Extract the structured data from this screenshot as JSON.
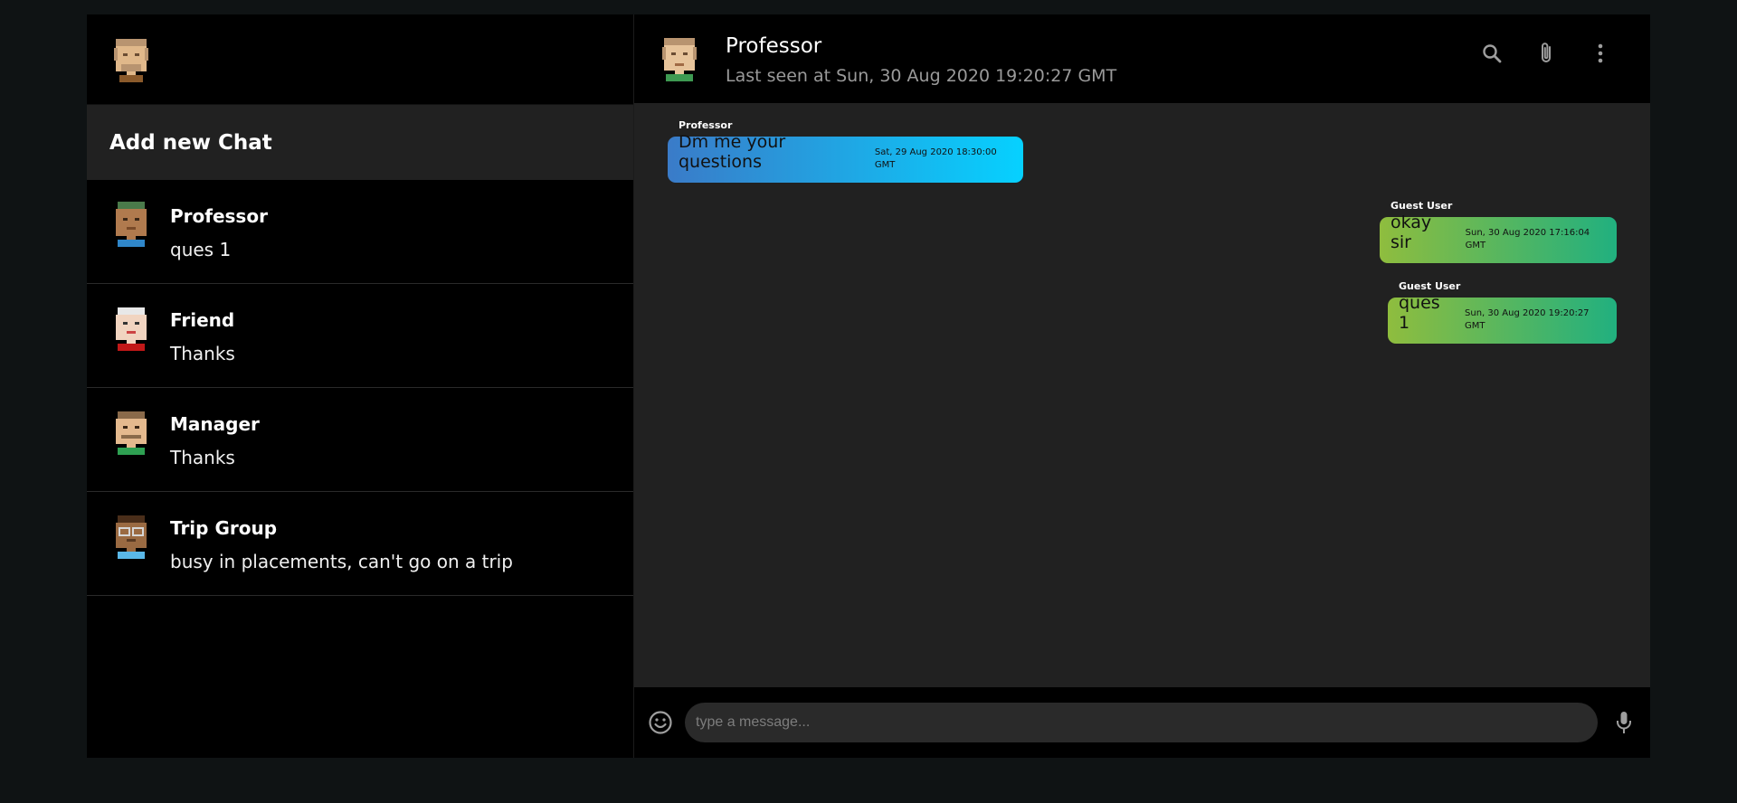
{
  "sidebar": {
    "add_chat_label": "Add new Chat",
    "chats": [
      {
        "name": "Professor",
        "last": "ques 1"
      },
      {
        "name": "Friend",
        "last": "Thanks"
      },
      {
        "name": "Manager",
        "last": "Thanks"
      },
      {
        "name": "Trip Group",
        "last": "busy in placements, can't go on a trip"
      }
    ]
  },
  "chat": {
    "title": "Professor",
    "subtitle": "Last seen at Sun, 30 Aug 2020 19:20:27 GMT",
    "messages": [
      {
        "sender": "Professor",
        "text": "Dm me your questions",
        "time": "Sat, 29 Aug 2020 18:30:00 GMT",
        "side": "in"
      },
      {
        "sender": "Guest User",
        "text": "okay sir",
        "time": "Sun, 30 Aug 2020 17:16:04 GMT",
        "side": "out"
      },
      {
        "sender": "Guest User",
        "text": "ques 1",
        "time": "Sun, 30 Aug 2020 19:20:27 GMT",
        "side": "out"
      }
    ],
    "input_placeholder": "type a message..."
  },
  "icons": {
    "header": [
      "search-icon",
      "paperclip-icon",
      "more-vertical-icon"
    ],
    "footer": [
      "emoji-icon",
      "microphone-icon"
    ]
  },
  "colors": {
    "incoming_start": "#3a7bc8",
    "incoming_end": "#06d1ff",
    "outgoing_start": "#8fbd3e",
    "outgoing_end": "#21b07f"
  }
}
